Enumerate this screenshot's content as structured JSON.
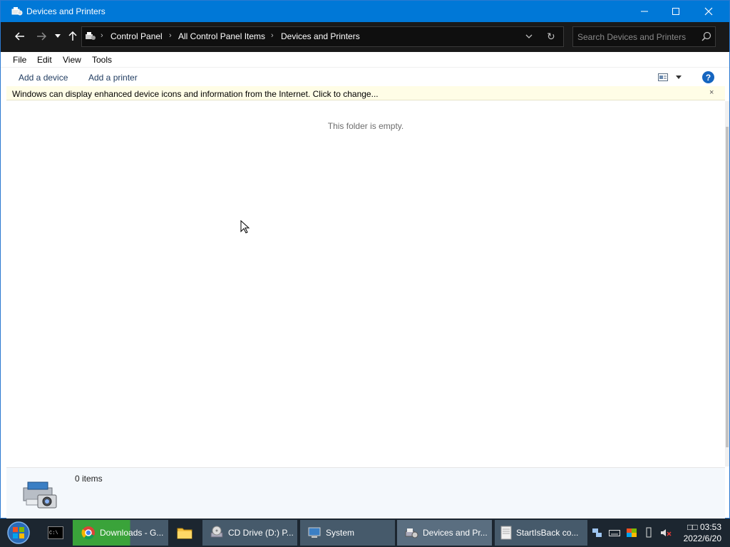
{
  "window": {
    "title": "Devices and Printers"
  },
  "navigation": {
    "breadcrumbs": [
      "Control Panel",
      "All Control Panel Items",
      "Devices and Printers"
    ],
    "search_placeholder": "Search Devices and Printers"
  },
  "menu": [
    "File",
    "Edit",
    "View",
    "Tools"
  ],
  "commands": {
    "add_device": "Add a device",
    "add_printer": "Add a printer"
  },
  "infobar": {
    "message": "Windows can display enhanced device icons and information from the Internet. Click to change...",
    "close_glyph": "×"
  },
  "content": {
    "empty_message": "This folder is empty."
  },
  "details": {
    "item_count": "0 items"
  },
  "taskbar": {
    "items": [
      {
        "label": "Downloads - G...",
        "icon": "chrome-icon"
      },
      {
        "label": "CD Drive (D:) P...",
        "icon": "cd-drive-icon"
      },
      {
        "label": "System",
        "icon": "system-icon"
      },
      {
        "label": "Devices and Pr...",
        "icon": "devices-printers-icon"
      },
      {
        "label": "StartIsBack co...",
        "icon": "document-icon"
      }
    ],
    "clock_time": "□□ 03:53",
    "clock_date": "2022/6/20"
  },
  "colors": {
    "titlebar": "#0078d7",
    "nav_background": "#191919",
    "infobar": "#fffde6",
    "taskbar": "#1c2630"
  }
}
